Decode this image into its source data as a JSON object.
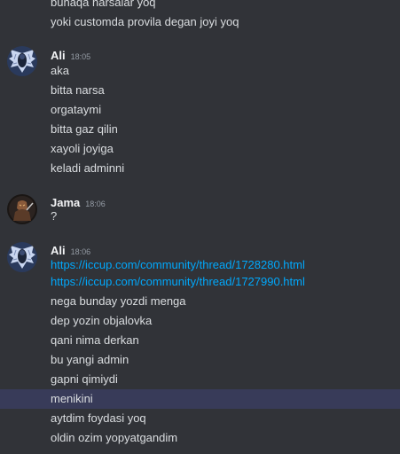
{
  "messages": [
    {
      "author": null,
      "lines": [
        "bunaqa narsalar yoq",
        "yoki customda provila degan joyi yoq"
      ]
    },
    {
      "author": "Ali",
      "time": "18:05",
      "avatar": "winged-angel-avatar",
      "lines": [
        "aka",
        "bitta narsa",
        "orgataymi",
        "bitta gaz qilin",
        "xayoli joyiga",
        "keladi adminni"
      ]
    },
    {
      "author": "Jama",
      "time": "18:06",
      "avatar": "dark-warrior-avatar",
      "lines": [
        "?"
      ]
    },
    {
      "author": "Ali",
      "time": "18:06",
      "avatar": "winged-angel-avatar",
      "links": [
        "https://iccup.com/community/thread/1728280.html",
        "https://iccup.com/community/thread/1727990.html"
      ],
      "lines": [
        "nega bunday yozdi menga",
        "dep yozin objalovka",
        "qani nima derkan",
        "bu yangi admin",
        "gapni qimiydi",
        "menikini",
        "aytdim foydasi yoq",
        "oldin ozim yopyatgandim"
      ]
    }
  ],
  "colors": {
    "background": "#313338",
    "text": "#dbdee1",
    "username": "#f2f3f5",
    "timestamp": "#949ba4",
    "link": "#00a8fc",
    "highlight": "#2e3248"
  }
}
